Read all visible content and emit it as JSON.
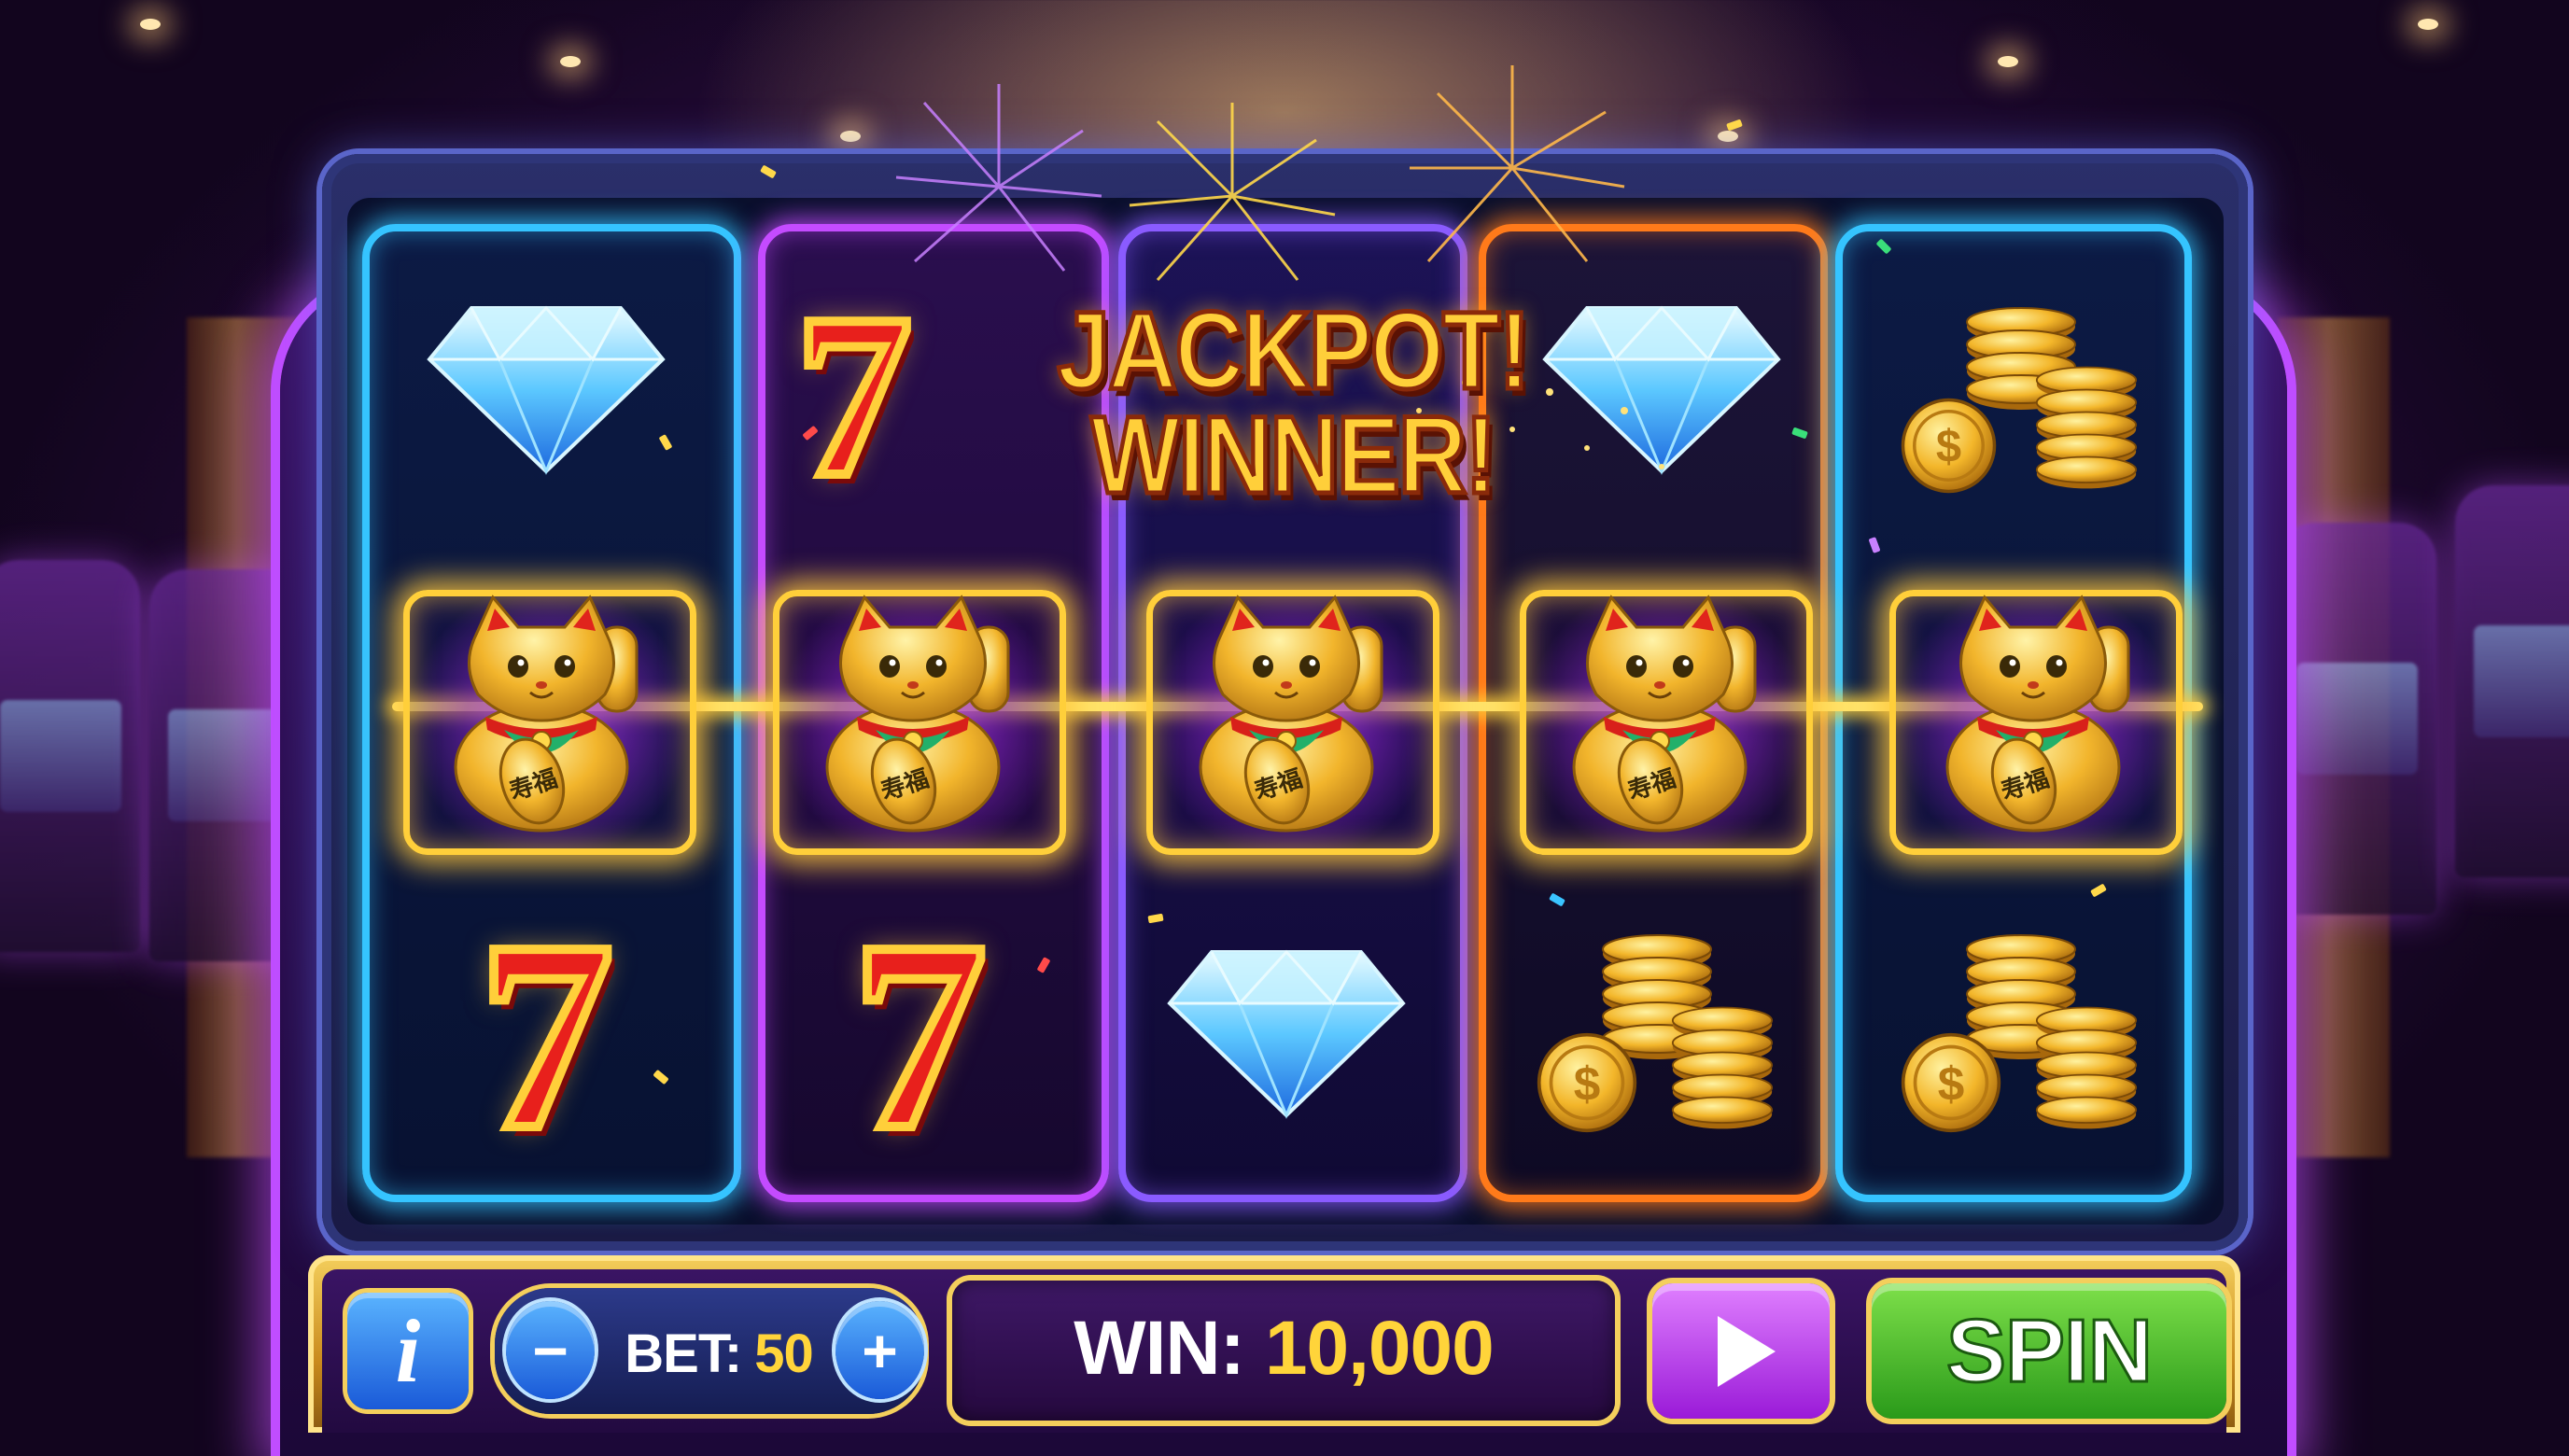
{
  "jackpot": {
    "seven": "7",
    "line1": "JACKPOT!",
    "line2": "WINNER!"
  },
  "reels": [
    {
      "color": "#35c4ff",
      "symbols": [
        "diamond-icon",
        "lucky-cat-icon",
        "seven-icon"
      ]
    },
    {
      "color": "#c44bff",
      "symbols": [
        "seven-icon",
        "lucky-cat-icon",
        "seven-icon"
      ]
    },
    {
      "color": "#8a5bff",
      "symbols": [
        "",
        "lucky-cat-icon",
        "diamond-icon"
      ]
    },
    {
      "color": "#ff7a1a",
      "symbols": [
        "diamond-icon",
        "lucky-cat-icon",
        "coins-icon"
      ]
    },
    {
      "color": "#35c4ff",
      "symbols": [
        "coins-icon",
        "lucky-cat-icon",
        "coins-icon"
      ]
    }
  ],
  "symbols": {
    "seven": "7",
    "cat_charm": "寿福"
  },
  "controls": {
    "info_label": "i",
    "bet_minus": "−",
    "bet_plus": "+",
    "bet_label": "BET:",
    "bet_value": "50",
    "win_label": "WIN:",
    "win_value": "10,000",
    "spin_label": "SPIN"
  },
  "colors": {
    "gold": "#ffcf3a",
    "seven_red": "#e8201c",
    "spin_green": "#2a9a1a",
    "play_purple": "#9a1ad8",
    "info_blue": "#1a5ad8"
  }
}
